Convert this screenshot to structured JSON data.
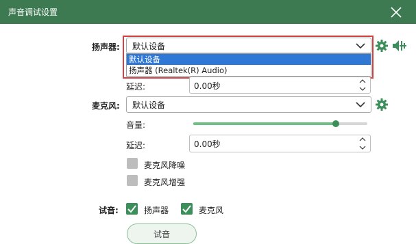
{
  "window": {
    "title": "声音调试设置"
  },
  "speaker": {
    "label": "扬声器:",
    "selected": "默认设备",
    "options": [
      "默认设备",
      "扬声器 (Realtek(R) Audio)"
    ],
    "delay_label": "延迟:",
    "delay_value": "0.00秒"
  },
  "mic": {
    "label": "麦克风:",
    "selected": "默认设备",
    "volume_label": "音量:",
    "volume_level": 0.82,
    "delay_label": "延迟:",
    "delay_value": "0.00秒",
    "noise_label": "麦克风降噪",
    "noise_checked": false,
    "boost_label": "麦克风增强",
    "boost_checked": false
  },
  "test": {
    "label": "试音:",
    "speaker_label": "扬声器",
    "speaker_checked": true,
    "mic_label": "麦克风",
    "mic_checked": true,
    "button_label": "试音"
  },
  "colors": {
    "titlebar": "#3d7a52",
    "accent": "#3c8f5b",
    "highlight_border": "#d64040",
    "selected_option": "#2f78d6"
  },
  "icons": {
    "close": "close-icon",
    "gear": "gear-icon",
    "speaker_settings": "speaker-volume-icon",
    "chevron": "chevron-down-icon",
    "check": "check-icon"
  }
}
